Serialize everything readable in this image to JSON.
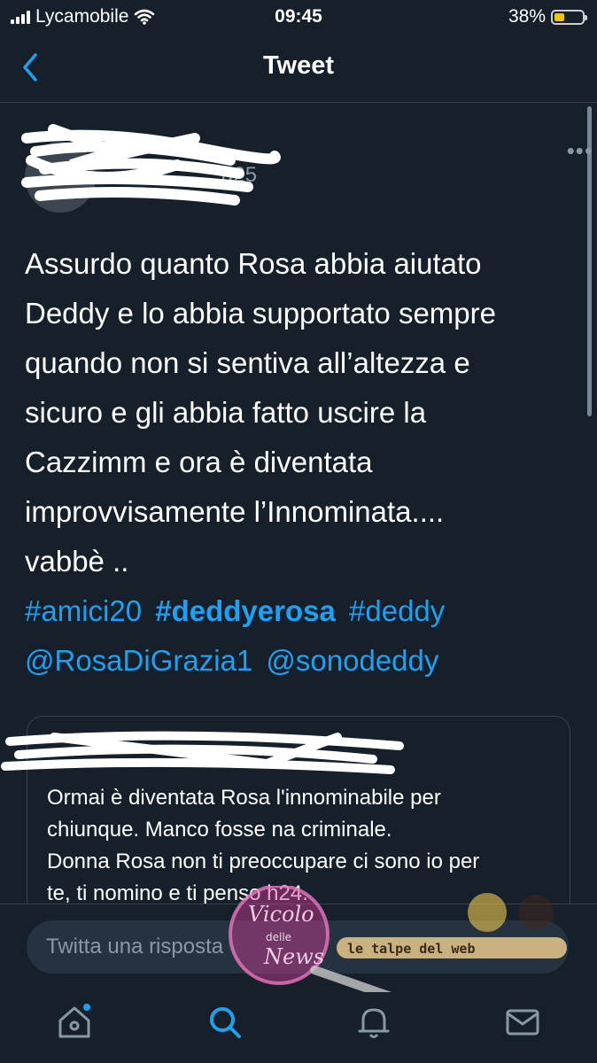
{
  "status_bar": {
    "carrier": "Lycamobile",
    "time": "09:45",
    "battery": "38%",
    "battery_level": 0.38,
    "battery_color": "#f5c400"
  },
  "nav": {
    "back_icon": "chevron-left-icon",
    "title": "Tweet"
  },
  "tweet": {
    "handle_partial": "a25",
    "more_icon": "more-horizontal-icon",
    "text_lines": [
      "Assurdo quanto Rosa abbia aiutato",
      "Deddy e lo abbia supportato sempre",
      "quando non si sentiva all’altezza e",
      "sicuro e gli abbia fatto uscire la",
      "Cazzimm e ora è diventata",
      "improvvisamente l’Innominata....",
      "vabbè .."
    ],
    "hashtags": [
      "#amici20",
      "#deddyerosa",
      "#deddy"
    ],
    "mentions": [
      "@RosaDiGrazia1",
      "@sonodeddy"
    ],
    "link_color": "#1da1f2"
  },
  "quoted_tweet": {
    "text_lines": [
      "Ormai è diventata Rosa l'innominabile per",
      "chiunque. Manco fosse na criminale.",
      "Donna Rosa non ti preoccupare ci sono io per",
      "te, ti nomino e ti penso h24."
    ]
  },
  "reply": {
    "placeholder": "Twitta una risposta"
  },
  "watermark": {
    "text_1": "Vicolo",
    "text_2": "delle",
    "text_3": "News",
    "text_4": "le talpe del web"
  },
  "tab_bar": {
    "items": [
      "home-icon",
      "search-icon",
      "notifications-icon",
      "messages-icon"
    ],
    "active": "search-icon",
    "accent": "#1da1f2"
  }
}
